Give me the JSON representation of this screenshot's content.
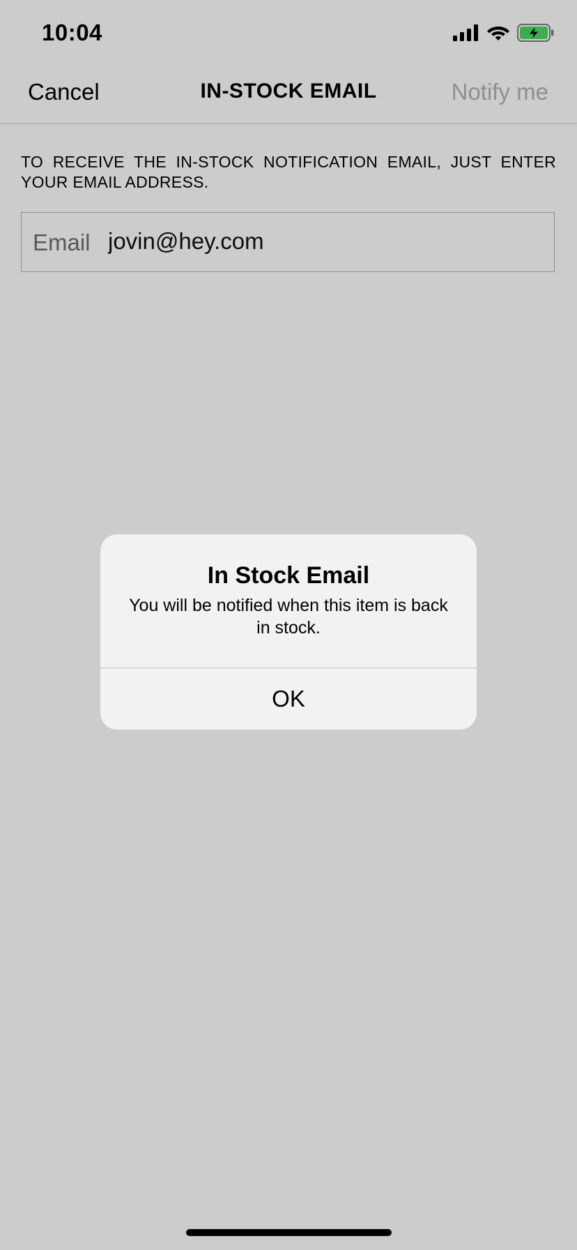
{
  "status_bar": {
    "time": "10:04",
    "icons": [
      "cellular-signal-icon",
      "wifi-icon",
      "battery-charging-icon"
    ],
    "battery_color": "#4cd964"
  },
  "nav": {
    "cancel_label": "Cancel",
    "title": "IN-STOCK EMAIL",
    "notify_label": "Notify me"
  },
  "form": {
    "instructions": "TO RECEIVE THE IN-STOCK NOTIFICATION EMAIL, JUST ENTER YOUR EMAIL ADDRESS.",
    "email_label": "Email",
    "email_value": "jovin@hey.com"
  },
  "alert": {
    "title": "In Stock Email",
    "message": "You will be notified when this item is back in stock.",
    "button_label": "OK"
  }
}
